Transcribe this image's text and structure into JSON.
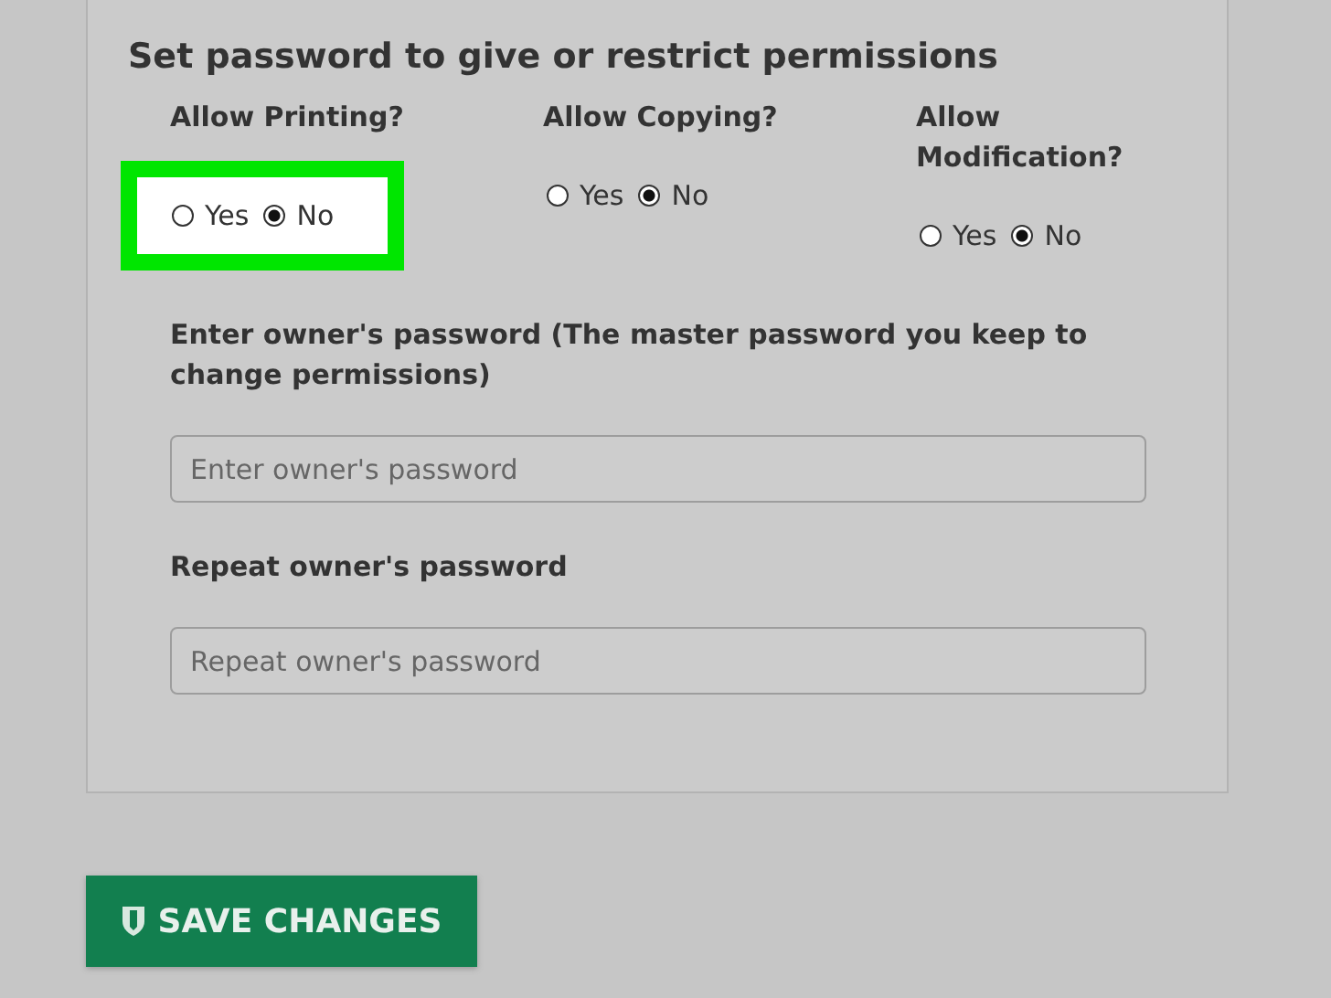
{
  "panel": {
    "title": "Set password to give or restrict permissions",
    "permissions": [
      {
        "label": "Allow Printing?",
        "highlighted": true,
        "options": [
          {
            "label": "Yes",
            "selected": false
          },
          {
            "label": "No",
            "selected": true
          }
        ]
      },
      {
        "label": "Allow Copying?",
        "highlighted": false,
        "options": [
          {
            "label": "Yes",
            "selected": false
          },
          {
            "label": "No",
            "selected": true
          }
        ]
      },
      {
        "label": "Allow Modification?",
        "highlighted": false,
        "options": [
          {
            "label": "Yes",
            "selected": false
          },
          {
            "label": "No",
            "selected": true
          }
        ]
      }
    ],
    "fields": [
      {
        "label": "Enter owner's password (The master password you keep to change permissions)",
        "placeholder": "Enter owner's password"
      },
      {
        "label": "Repeat owner's password",
        "placeholder": "Repeat owner's password"
      }
    ]
  },
  "save_button": {
    "label": "SAVE CHANGES"
  }
}
